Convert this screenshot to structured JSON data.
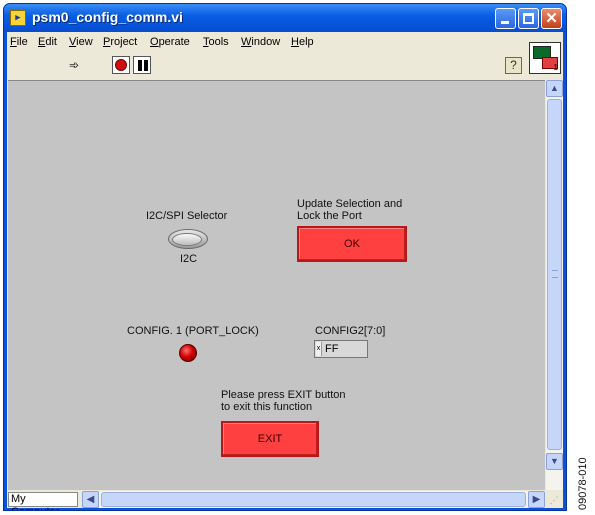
{
  "window": {
    "title": "psm0_config_comm.vi",
    "title_icon_glyph": "▶",
    "controls": {
      "minimize": "minimize-icon",
      "maximize": "maximize-icon",
      "close": "close-icon"
    }
  },
  "menubar": {
    "items": [
      {
        "label": "File",
        "mnemonic": "F",
        "rest": "ile"
      },
      {
        "label": "Edit",
        "mnemonic": "E",
        "rest": "dit"
      },
      {
        "label": "View",
        "mnemonic": "V",
        "rest": "iew"
      },
      {
        "label": "Project",
        "mnemonic": "P",
        "rest": "roject"
      },
      {
        "label": "Operate",
        "mnemonic": "O",
        "rest": "perate"
      },
      {
        "label": "Tools",
        "mnemonic": "T",
        "rest": "ools"
      },
      {
        "label": "Window",
        "mnemonic": "W",
        "rest": "indow"
      },
      {
        "label": "Help",
        "mnemonic": "H",
        "rest": "elp"
      }
    ]
  },
  "toolbar": {
    "run_icon": "run-arrow-icon",
    "run_glyph": "➾",
    "abort_icon": "abort-execution-icon",
    "pause_icon": "pause-icon",
    "help_glyph": "?"
  },
  "vi_icon": {
    "number": "1"
  },
  "panel": {
    "selector_label": "I2C/SPI Selector",
    "selector_value": "I2C",
    "update_label_line1": "Update Selection and",
    "update_label_line2": "Lock the Port",
    "ok_label": "OK",
    "config1_label": "CONFIG. 1 (PORT_LOCK)",
    "config2_label": "CONFIG2[7:0]",
    "config2_radix": "x",
    "config2_value": "FF",
    "exit_instr_line1": "Please press EXIT button",
    "exit_instr_line2": "to exit this function",
    "exit_label": "EXIT"
  },
  "scroll": {
    "up": "▲",
    "down": "▼",
    "left": "◀",
    "right": "▶"
  },
  "status": {
    "context": "My Computer"
  },
  "figure_id": "09078-010",
  "colors": {
    "panel_bg": "#c4c4c4",
    "button_red": "#ff4040",
    "led_on": "#d00000",
    "titlebar_blue": "#0a5fe4"
  }
}
